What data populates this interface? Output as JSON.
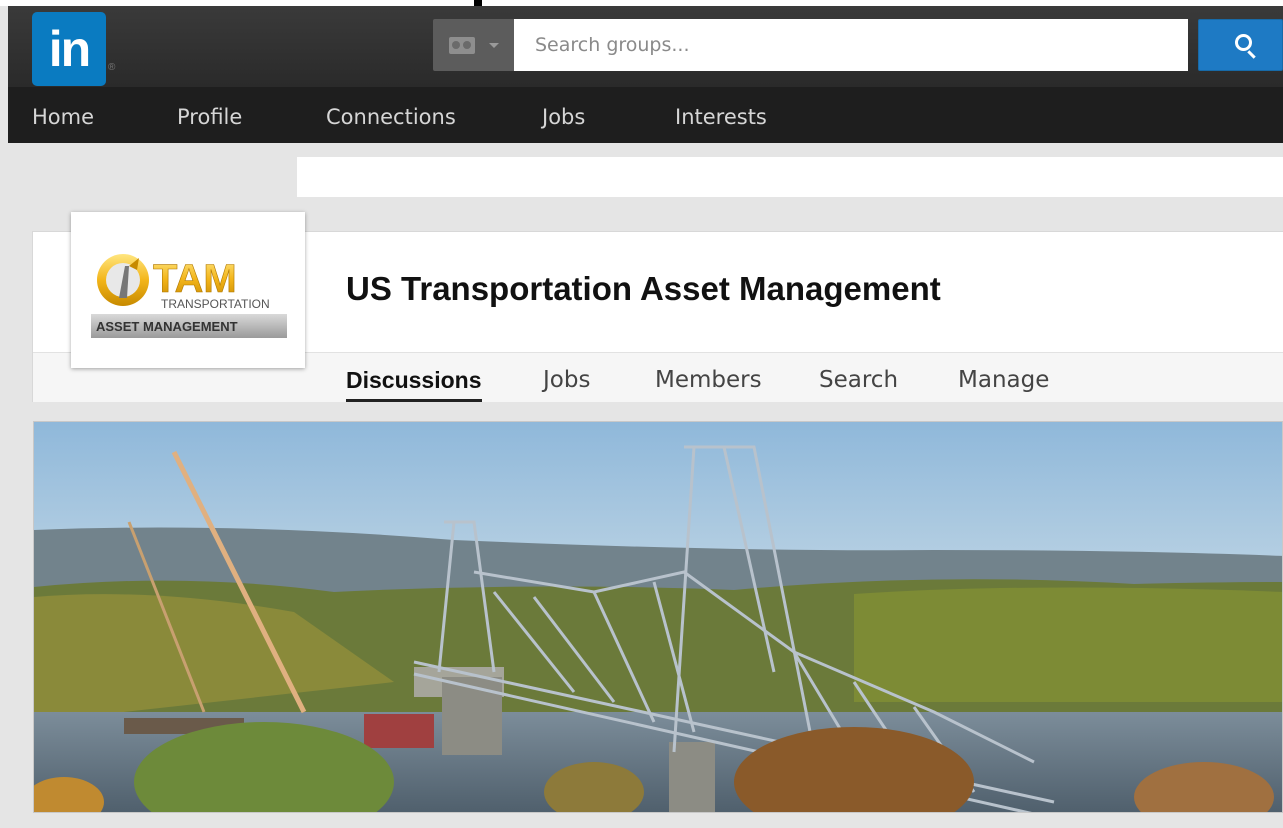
{
  "brand": {
    "logo_text": "in",
    "colors": {
      "linkedin_blue": "#0a7bc1",
      "search_button": "#1e7ac4",
      "nav_bg": "#1e1e1e",
      "header_bg": "#333333"
    }
  },
  "search": {
    "placeholder": "Search groups...",
    "type_icon": "group-icon",
    "button_icon": "search-icon"
  },
  "nav": {
    "items": [
      {
        "label": "Home"
      },
      {
        "label": "Profile"
      },
      {
        "label": "Connections"
      },
      {
        "label": "Jobs"
      },
      {
        "label": "Interests"
      }
    ]
  },
  "group": {
    "title": "US Transportation Asset Management",
    "logo": {
      "primary": "TAM",
      "line1": "TRANSPORTATION",
      "line2": "ASSET MANAGEMENT"
    },
    "tabs": [
      {
        "label": "Discussions",
        "active": true
      },
      {
        "label": "Jobs",
        "active": false
      },
      {
        "label": "Members",
        "active": false
      },
      {
        "label": "Search",
        "active": false
      },
      {
        "label": "Manage",
        "active": false
      }
    ]
  }
}
